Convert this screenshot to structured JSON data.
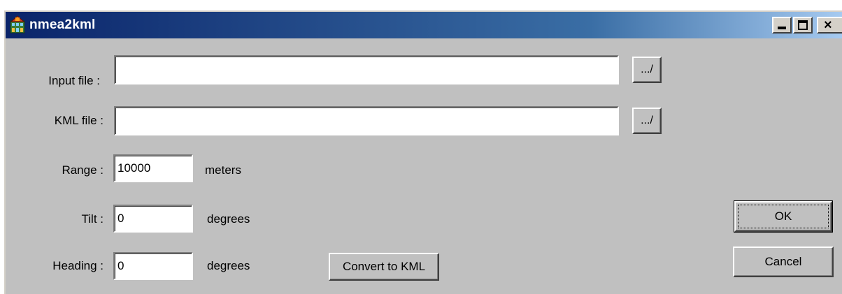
{
  "window": {
    "title": "nmea2kml",
    "close_glyph": "×",
    "icons": {
      "app": "nmea2kml-app-icon",
      "minimize": "minimize-icon",
      "maximize": "maximize-icon",
      "close": "close-icon"
    }
  },
  "form": {
    "input_file": {
      "label": "Input file :",
      "value": "",
      "browse_label": "..."
    },
    "kml_file": {
      "label": "KML file :",
      "value": "",
      "browse_label": "..."
    },
    "range": {
      "label": "Range :",
      "value": "10000",
      "unit": "meters"
    },
    "tilt": {
      "label": "Tilt :",
      "value": "0",
      "unit": "degrees"
    },
    "heading": {
      "label": "Heading :",
      "value": "0",
      "unit": "degrees"
    }
  },
  "buttons": {
    "convert": "Convert to KML",
    "ok": "OK",
    "cancel": "Cancel"
  },
  "colors": {
    "titlebar_start": "#0a246a",
    "titlebar_end": "#a6caf0",
    "window_bg": "#c0c0c0"
  }
}
